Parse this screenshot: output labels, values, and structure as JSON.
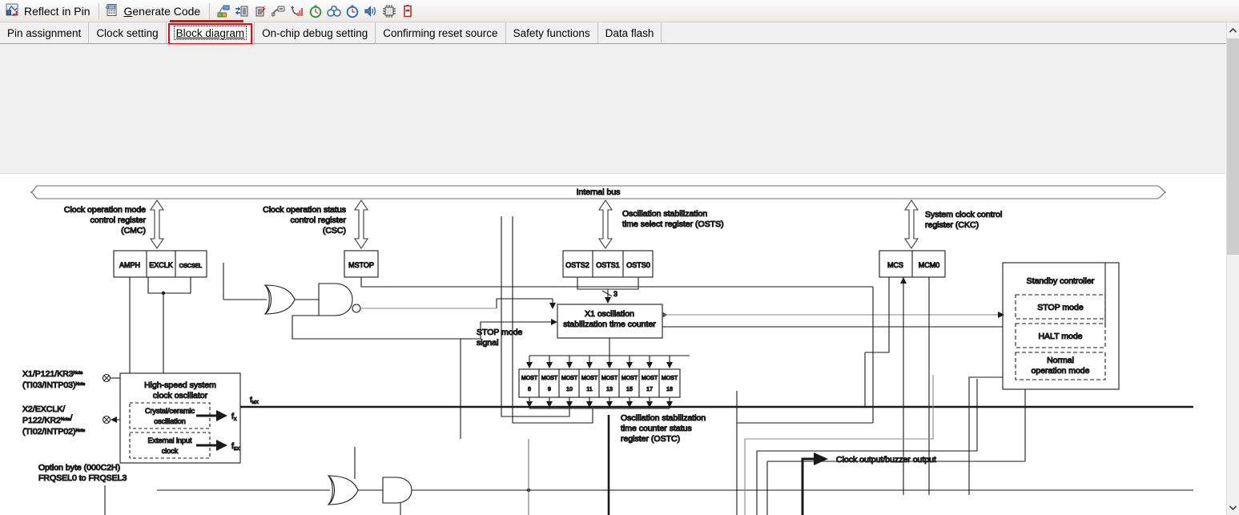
{
  "toolbar": {
    "buttons": [
      {
        "icon": "reflect-in-pin-icon",
        "label": "Reflect in Pin"
      },
      {
        "icon": "generate-code-icon",
        "label_first": "G",
        "label_rest": "enerate Code",
        "label": "Generate Code"
      }
    ],
    "icons": [
      "pin-configurator-icon",
      "device-transfer-icon",
      "device-pin-error-icon",
      "debug-probe-icon",
      "analysis-graph-icon",
      "timer-green-icon",
      "binoculars-icon",
      "stopwatch-icon",
      "speaker-icon",
      "chip-grid-icon",
      "battery-icon"
    ]
  },
  "tabs": [
    {
      "label": "Pin assignment",
      "selected": false
    },
    {
      "label": "Clock setting",
      "selected": false
    },
    {
      "label": "Block diagram",
      "selected": true
    },
    {
      "label": "On-chip debug setting",
      "selected": false
    },
    {
      "label": "Confirming reset source",
      "selected": false
    },
    {
      "label": "Safety functions",
      "selected": false
    },
    {
      "label": "Data flash",
      "selected": false
    }
  ],
  "scrollbar": {
    "up_arrow": "chevron-up-icon",
    "down_arrow": "chevron-down-icon"
  },
  "diagram": {
    "internal_bus": "Internal bus",
    "registers": [
      {
        "caption": [
          "Clock operation mode",
          "control register",
          "(CMC)"
        ],
        "fields": [
          "AMPH",
          "EXCLK",
          "OSCSEL"
        ]
      },
      {
        "caption": [
          "Clock operation status",
          "control register",
          "(CSC)"
        ],
        "fields": [
          "MSTOP"
        ]
      },
      {
        "caption": [
          "Oscillation stabilization",
          "time select register (OSTS)"
        ],
        "fields": [
          "OSTS2",
          "OSTS1",
          "OSTS0"
        ]
      },
      {
        "caption": [
          "System clock control",
          "register (CKC)"
        ],
        "fields": [
          "MCS",
          "MCM0"
        ]
      }
    ],
    "bus_width_label": "3",
    "counter_block": [
      "X1 oscillation",
      "stabilization time counter"
    ],
    "most_registers": [
      {
        "name": "MOST",
        "index": "8"
      },
      {
        "name": "MOST",
        "index": "9"
      },
      {
        "name": "MOST",
        "index": "10"
      },
      {
        "name": "MOST",
        "index": "11"
      },
      {
        "name": "MOST",
        "index": "13"
      },
      {
        "name": "MOST",
        "index": "15"
      },
      {
        "name": "MOST",
        "index": "17"
      },
      {
        "name": "MOST",
        "index": "18"
      }
    ],
    "ostc_caption": [
      "Oscillation stabilization",
      "time counter status",
      "register (OSTC)"
    ],
    "stop_mode_signal": [
      "STOP mode",
      "signal"
    ],
    "oscillator": {
      "title": [
        "High-speed system",
        "clock oscillator"
      ],
      "sub_blocks": [
        {
          "lines": [
            "Crystal/ceramic",
            "oscillation"
          ],
          "output": "fX"
        },
        {
          "lines": [
            "External input",
            "clock"
          ],
          "output": "fEX"
        }
      ],
      "bus_output": "fMX"
    },
    "pins": [
      {
        "lines": [
          "X1/P121/KR3",
          "(TI03/INTP03)"
        ],
        "note": "Note"
      },
      {
        "lines": [
          "X2/EXCLK/",
          "P122/KR2",
          "(TI02/INTP02)"
        ],
        "note": "Note"
      }
    ],
    "option_byte": [
      "Option byte (000C2H)",
      "FRQSEL0 to FRQSEL3"
    ],
    "standby_controller": {
      "title": "Standby controller",
      "modes": [
        "STOP mode",
        "HALT mode",
        "Normal\noperation mode"
      ],
      "mode_lines": [
        [
          "STOP mode"
        ],
        [
          "HALT mode"
        ],
        [
          "Normal",
          "operation mode"
        ]
      ]
    },
    "clock_output": "Clock output/buzzer output"
  },
  "colors": {
    "highlight": "#ff0000",
    "toolbar_bg": "#f0f0f0",
    "content_bg": "#ffffff",
    "band_bg": "#f0f0f0",
    "line": "#1a1a1a",
    "scrollbar_thumb": "#cdcdcd"
  }
}
